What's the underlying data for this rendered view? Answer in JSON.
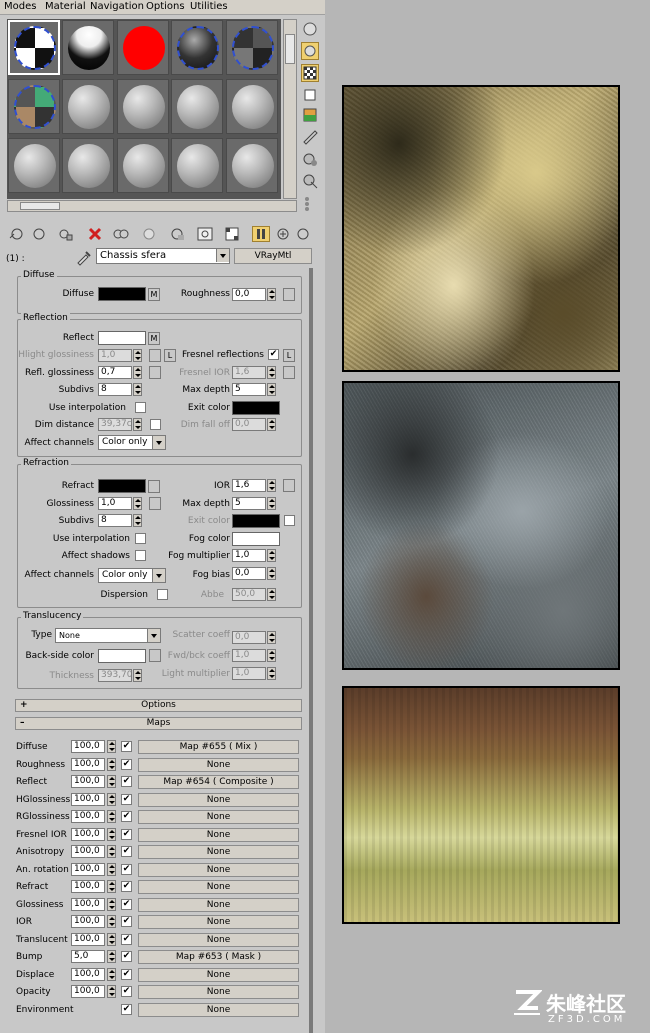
{
  "menu": [
    "Modes",
    "Material",
    "Navigation",
    "Options",
    "Utilities"
  ],
  "material_name": "Chassis sfera",
  "slot_label": "(1) :",
  "material_type": "VRayMtl",
  "diffuse": {
    "title": "Diffuse",
    "diffuse_label": "Diffuse",
    "diffuse_color": "#000000",
    "m_label": "M",
    "roughness_label": "Roughness",
    "roughness_value": "0,0"
  },
  "reflection": {
    "title": "Reflection",
    "reflect_label": "Reflect",
    "reflect_color": "#ffffff",
    "m_label": "M",
    "hilight_label": "Hlight glossiness",
    "hilight_value": "1,0",
    "l_label": "L",
    "fresnel_label": "Fresnel reflections",
    "fresnel_check": "✔",
    "fresnel_l": "L",
    "refl_gloss_label": "Refl. glossiness",
    "refl_gloss_value": "0,7",
    "fresnel_ior_label": "Fresnel IOR",
    "fresnel_ior_value": "1,6",
    "subdivs_label": "Subdivs",
    "subdivs_value": "8",
    "max_depth_label": "Max depth",
    "max_depth_value": "5",
    "use_interp_label": "Use interpolation",
    "exit_color_label": "Exit color",
    "exit_color": "#000000",
    "dim_distance_label": "Dim distance",
    "dim_distance_value": "39,37c",
    "dim_falloff_label": "Dim fall off",
    "dim_falloff_value": "0,0",
    "affect_label": "Affect channels",
    "affect_value": "Color only"
  },
  "refraction": {
    "title": "Refraction",
    "refract_label": "Refract",
    "refract_color": "#000000",
    "ior_label": "IOR",
    "ior_value": "1,6",
    "gloss_label": "Glossiness",
    "gloss_value": "1,0",
    "max_depth_label": "Max depth",
    "max_depth_value": "5",
    "subdivs_label": "Subdivs",
    "subdivs_value": "8",
    "exit_color_label": "Exit color",
    "exit_color": "#000000",
    "use_interp_label": "Use interpolation",
    "fog_color_label": "Fog color",
    "fog_color": "#ffffff",
    "affect_shadows_label": "Affect shadows",
    "fog_mult_label": "Fog multiplier",
    "fog_mult_value": "1,0",
    "affect_label": "Affect channels",
    "affect_value": "Color only",
    "fog_bias_label": "Fog bias",
    "fog_bias_value": "0,0",
    "dispersion_label": "Dispersion",
    "abbe_label": "Abbe",
    "abbe_value": "50,0"
  },
  "translucency": {
    "title": "Translucency",
    "type_label": "Type",
    "type_value": "None",
    "scatter_label": "Scatter coeff",
    "scatter_value": "0,0",
    "backside_label": "Back-side color",
    "backside_color": "#ffffff",
    "fwd_label": "Fwd/bck coeff",
    "fwd_value": "1,0",
    "thickness_label": "Thickness",
    "thickness_value": "393,70",
    "light_mult_label": "Light multiplier",
    "light_mult_value": "1,0"
  },
  "rollouts": {
    "options_sign": "+",
    "options": "Options",
    "maps_sign": "–",
    "maps": "Maps"
  },
  "maps": [
    {
      "label": "Diffuse",
      "amount": "100,0",
      "check": "✔",
      "map": "Map #655  ( Mix )"
    },
    {
      "label": "Roughness",
      "amount": "100,0",
      "check": "✔",
      "map": "None"
    },
    {
      "label": "Reflect",
      "amount": "100,0",
      "check": "✔",
      "map": "Map #654  ( Composite )"
    },
    {
      "label": "HGlossiness",
      "amount": "100,0",
      "check": "✔",
      "map": "None"
    },
    {
      "label": "RGlossiness",
      "amount": "100,0",
      "check": "✔",
      "map": "None"
    },
    {
      "label": "Fresnel IOR",
      "amount": "100,0",
      "check": "✔",
      "map": "None"
    },
    {
      "label": "Anisotropy",
      "amount": "100,0",
      "check": "✔",
      "map": "None"
    },
    {
      "label": "An. rotation",
      "amount": "100,0",
      "check": "✔",
      "map": "None"
    },
    {
      "label": "Refract",
      "amount": "100,0",
      "check": "✔",
      "map": "None"
    },
    {
      "label": "Glossiness",
      "amount": "100,0",
      "check": "✔",
      "map": "None"
    },
    {
      "label": "IOR",
      "amount": "100,0",
      "check": "✔",
      "map": "None"
    },
    {
      "label": "Translucent",
      "amount": "100,0",
      "check": "✔",
      "map": "None"
    },
    {
      "label": "Bump",
      "amount": "5,0",
      "check": "✔",
      "map": "Map #653  ( Mask )"
    },
    {
      "label": "Displace",
      "amount": "100,0",
      "check": "✔",
      "map": "None"
    },
    {
      "label": "Opacity",
      "amount": "100,0",
      "check": "✔",
      "map": "None"
    },
    {
      "label": "Environment",
      "amount": "",
      "check": "✔",
      "map": "None"
    }
  ],
  "watermark": {
    "cn": "朱峰社区",
    "en": "ZF3D.COM"
  }
}
